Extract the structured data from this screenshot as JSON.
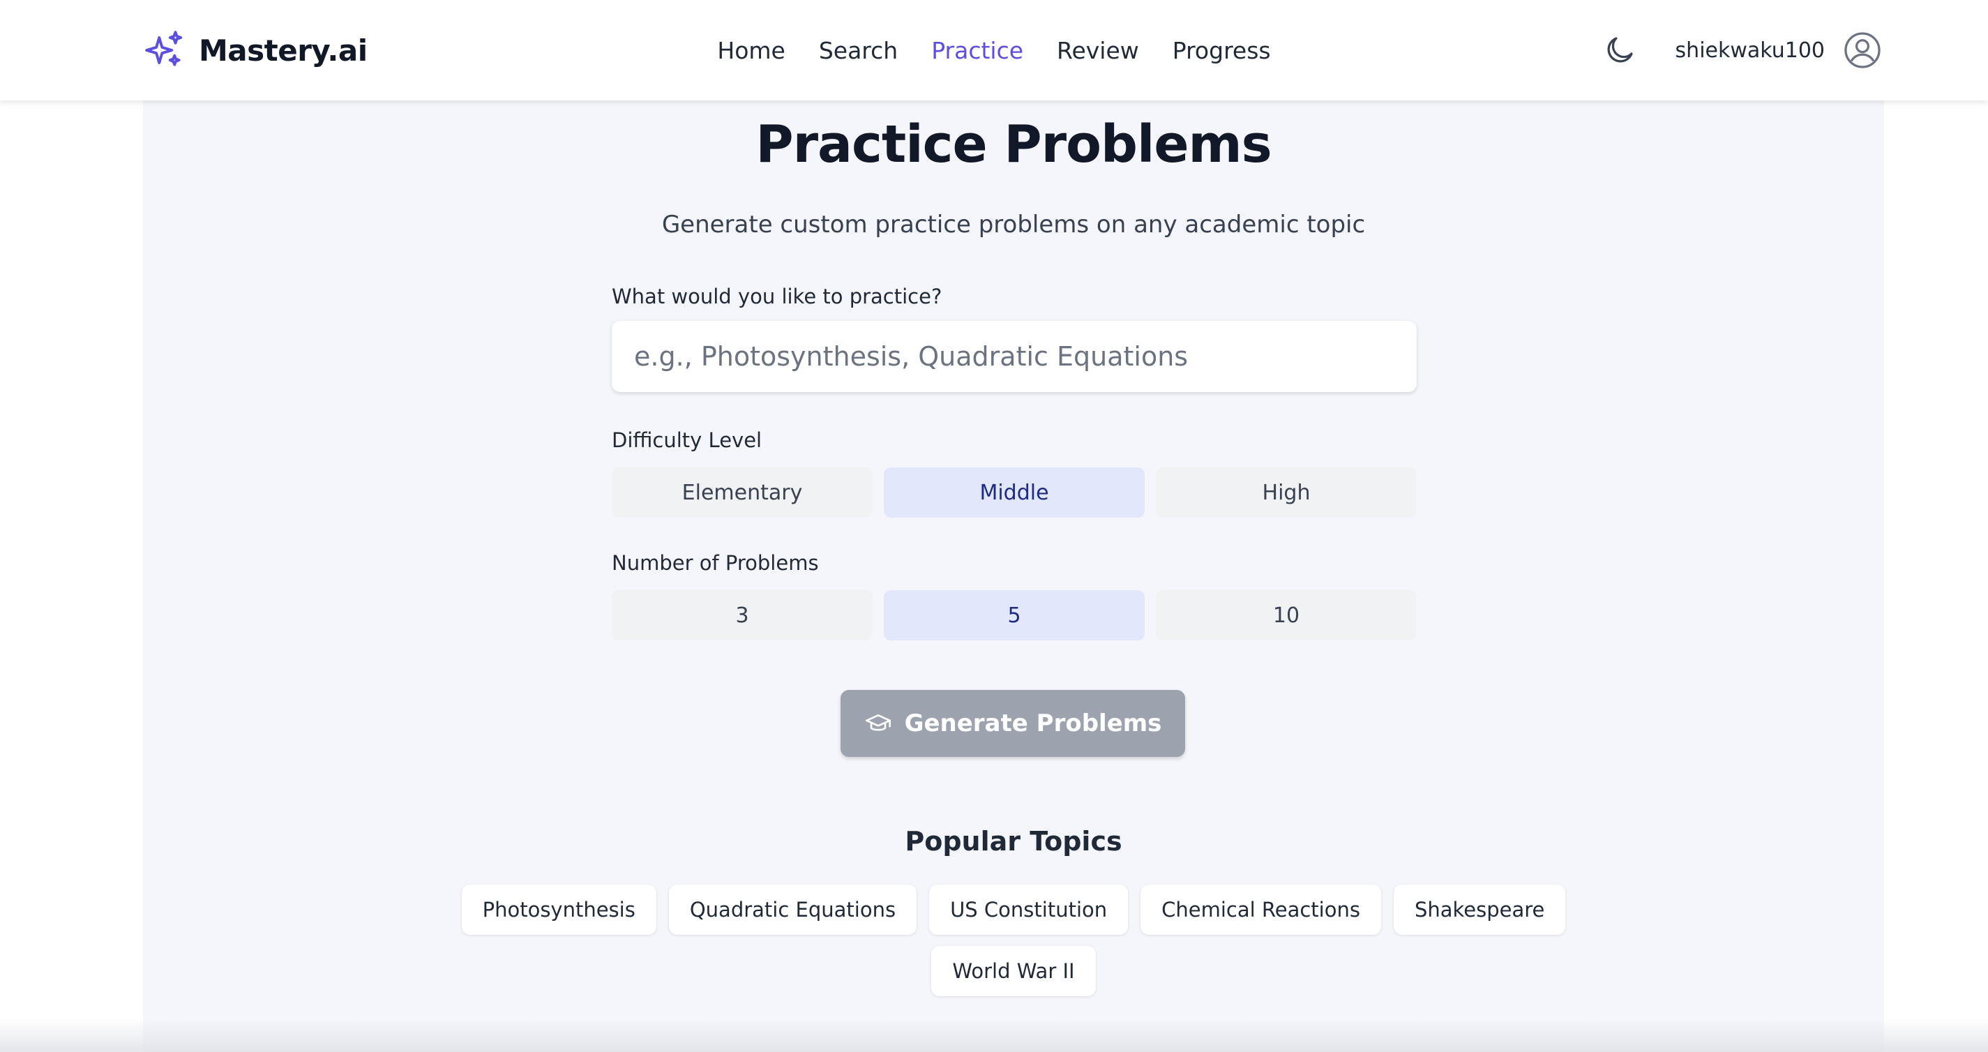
{
  "brand": {
    "name": "Mastery.ai",
    "icon": "sparkles-icon",
    "accent": "#5b4ee0"
  },
  "nav": {
    "items": [
      {
        "label": "Home",
        "active": false
      },
      {
        "label": "Search",
        "active": false
      },
      {
        "label": "Practice",
        "active": true
      },
      {
        "label": "Review",
        "active": false
      },
      {
        "label": "Progress",
        "active": false
      }
    ]
  },
  "user": {
    "username": "shiekwaku100",
    "theme_icon": "moon-icon",
    "avatar_icon": "user-circle-icon"
  },
  "page": {
    "title": "Practice Problems",
    "subtitle": "Generate custom practice problems on any academic topic"
  },
  "form": {
    "topic_label": "What would you like to practice?",
    "topic_placeholder": "e.g., Photosynthesis, Quadratic Equations",
    "topic_value": "",
    "difficulty_label": "Difficulty Level",
    "difficulty_options": [
      "Elementary",
      "Middle",
      "High"
    ],
    "difficulty_selected": "Middle",
    "count_label": "Number of Problems",
    "count_options": [
      "3",
      "5",
      "10"
    ],
    "count_selected": "5",
    "generate_label": "Generate Problems",
    "generate_icon": "graduation-cap-icon"
  },
  "popular": {
    "title": "Popular Topics",
    "topics": [
      "Photosynthesis",
      "Quadratic Equations",
      "US Constitution",
      "Chemical Reactions",
      "Shakespeare",
      "World War II"
    ]
  },
  "colors": {
    "active_nav": "#5b4ee0",
    "selected_option_bg": "#e2e7fb",
    "selected_option_text": "#1e2b86",
    "disabled_button": "#9ca3af"
  }
}
